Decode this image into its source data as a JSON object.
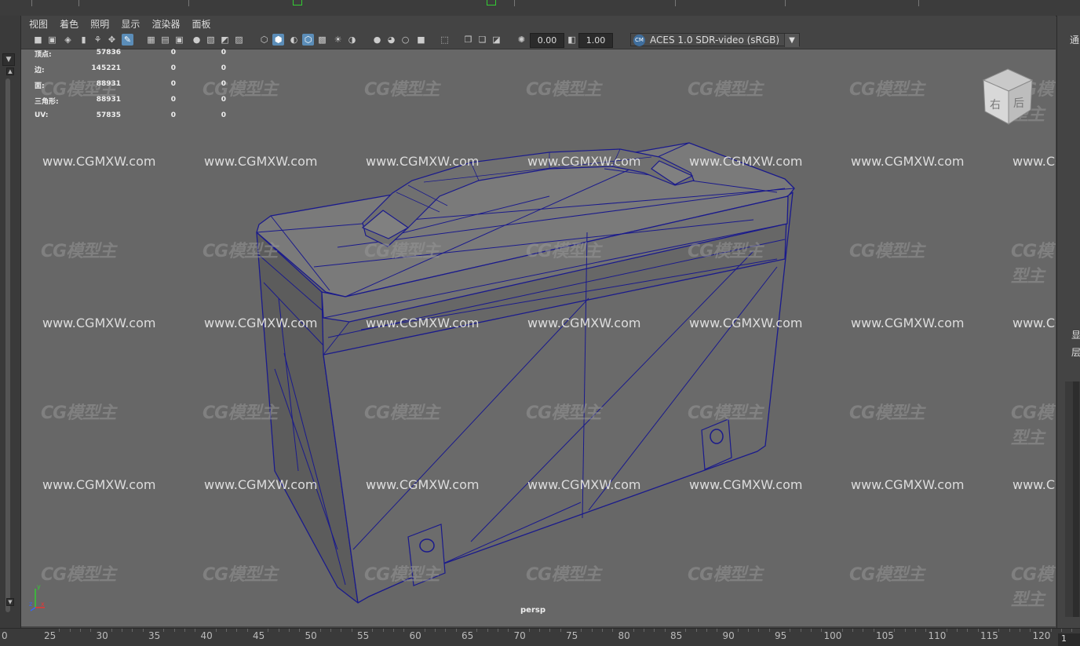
{
  "menu": {
    "items": [
      "视图",
      "着色",
      "照明",
      "显示",
      "渲染器",
      "面板"
    ]
  },
  "toolbar": {
    "exposure_value": "0.00",
    "gamma_value": "1.00",
    "color_space": "ACES 1.0 SDR-video (sRGB)",
    "color_space_badge": "CM"
  },
  "hud": {
    "rows": [
      {
        "label": "顶点:",
        "total": "57836",
        "selected": "0",
        "component": "0"
      },
      {
        "label": "边:",
        "total": "145221",
        "selected": "0",
        "component": "0"
      },
      {
        "label": "面:",
        "total": "88931",
        "selected": "0",
        "component": "0"
      },
      {
        "label": "三角形:",
        "total": "88931",
        "selected": "0",
        "component": "0"
      },
      {
        "label": "UV:",
        "total": "57835",
        "selected": "0",
        "component": "0"
      }
    ]
  },
  "viewcube": {
    "faces": [
      "右",
      "后"
    ]
  },
  "camera_label": "persp",
  "watermark": {
    "logo": "CG模型主",
    "url": "www.CGMXW.com"
  },
  "right_panel": {
    "top_label": "通",
    "item1": "显",
    "item2": "层"
  },
  "timeline": {
    "numbers": [
      "25",
      "30",
      "35",
      "40",
      "45",
      "50",
      "55",
      "60",
      "65",
      "70",
      "75",
      "80",
      "85",
      "90",
      "95",
      "100",
      "105",
      "110",
      "115",
      "120"
    ],
    "left_edge": "0",
    "current_frame": "1"
  },
  "colors": {
    "wireframe": "#1a1a8c",
    "viewport_bg": "#676767",
    "selected_tool": "#5b8db8"
  },
  "icons": [
    "camera-icon",
    "camera-attr-icon",
    "bookmark-icon",
    "image-plane-icon",
    "grid-icon",
    "film-gate-icon",
    "resolution-gate-icon",
    "wireframe-icon",
    "smooth-shade-icon",
    "textured-icon",
    "lighting-icon",
    "shadow-icon",
    "isolate-icon",
    "xray-icon",
    "hud-icon",
    "exposure-icon",
    "gamma-icon"
  ]
}
